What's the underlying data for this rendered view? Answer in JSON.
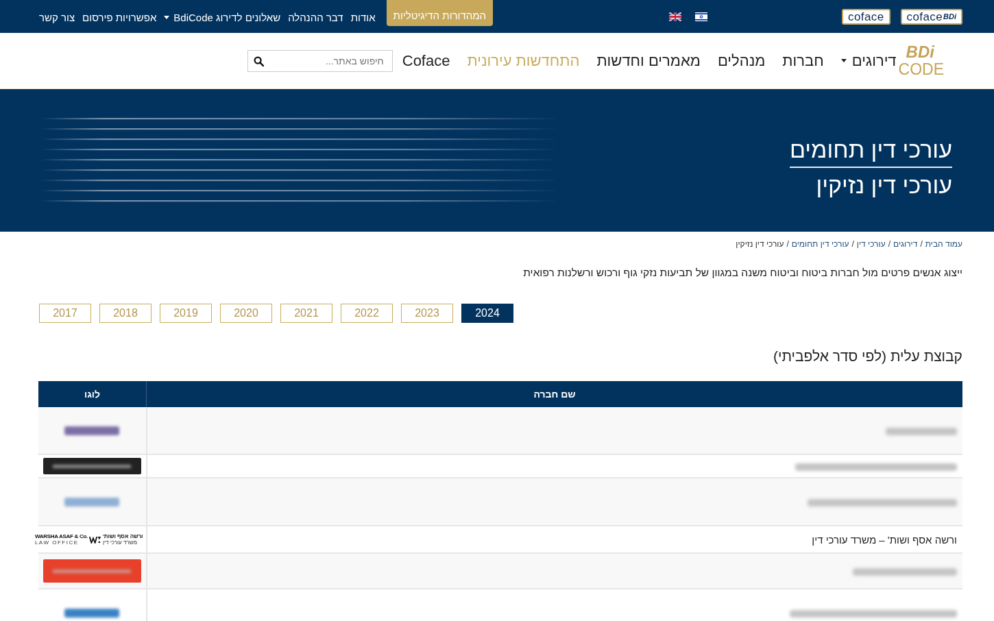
{
  "top_bar": {
    "partner_logos": [
      {
        "name": "coface",
        "badge": "BDi"
      },
      {
        "name": "coface"
      }
    ],
    "menu": [
      {
        "label": "המהדורות הדיגיטליות",
        "kind": "button"
      },
      {
        "label": "אודות",
        "kind": "link"
      },
      {
        "label": "דבר ההנהלה",
        "kind": "link"
      },
      {
        "label": "שאלונים לדירוג BdiCode",
        "kind": "dropdown"
      },
      {
        "label": "אפשרויות פירסום",
        "kind": "link"
      },
      {
        "label": "צור קשר",
        "kind": "link"
      }
    ]
  },
  "nav": {
    "logo": {
      "top": "BDi",
      "bottom": "CODE"
    },
    "items": [
      {
        "label": "דירוגים",
        "kind": "dropdown",
        "highlighted": false
      },
      {
        "label": "חברות",
        "kind": "link",
        "highlighted": false
      },
      {
        "label": "מנהלים",
        "kind": "link",
        "highlighted": false
      },
      {
        "label": "מאמרים וחדשות",
        "kind": "link",
        "highlighted": false
      },
      {
        "label": "התחדשות עירונית",
        "kind": "link",
        "highlighted": true
      },
      {
        "label": "Coface",
        "kind": "link",
        "highlighted": false
      }
    ],
    "search": {
      "placeholder": "חיפוש באתר..."
    }
  },
  "hero": {
    "title": "עורכי דין תחומים",
    "subtitle": "עורכי דין נזיקין"
  },
  "breadcrumb": {
    "separator": "/",
    "items": [
      {
        "label": "עמוד הבית",
        "current": false
      },
      {
        "label": "דירוגים",
        "current": false
      },
      {
        "label": "עורכי דין",
        "current": false
      },
      {
        "label": "עורכי דין תחומים",
        "current": false
      },
      {
        "label": "עורכי דין נזיקין",
        "current": true
      }
    ]
  },
  "description": "ייצוג אנשים פרטים מול חברות ביטוח וביטוח משנה במגוון של תביעות נזקי גוף ורכוש ורשלנות רפואית",
  "years": [
    {
      "label": "2024",
      "selected": true
    },
    {
      "label": "2023",
      "selected": false
    },
    {
      "label": "2022",
      "selected": false
    },
    {
      "label": "2021",
      "selected": false
    },
    {
      "label": "2020",
      "selected": false
    },
    {
      "label": "2019",
      "selected": false
    },
    {
      "label": "2018",
      "selected": false
    },
    {
      "label": "2017",
      "selected": false
    }
  ],
  "section_title": "קבוצת עלית (לפי סדר אלפביתי)",
  "table": {
    "columns": [
      "שם חברה",
      "לוגו"
    ],
    "rows": [
      {
        "kind": "blurred",
        "logo": {
          "kind": "emblem",
          "color": "#7d6fa6"
        }
      },
      {
        "kind": "blurred",
        "logo": {
          "kind": "banner",
          "color": "#222222"
        }
      },
      {
        "kind": "blurred",
        "logo": {
          "kind": "emblem",
          "color": "#8fb0d4"
        }
      },
      {
        "kind": "named",
        "name": "ורשה אסף ושות' – משרד עורכי דין",
        "logo": {
          "kind": "wordmark",
          "latin_name": "WARSHA ASAF & Co.",
          "latin_tagline": "LAW OFFICE",
          "hebrew_name": "ורשה אסף ושות'",
          "hebrew_tagline": "משרד עורכי דין"
        }
      },
      {
        "kind": "blurred",
        "logo": {
          "kind": "banner",
          "color": "#e8412b"
        }
      },
      {
        "kind": "blurred",
        "logo": {
          "kind": "emblem",
          "color": "#3b82c4"
        }
      }
    ]
  }
}
